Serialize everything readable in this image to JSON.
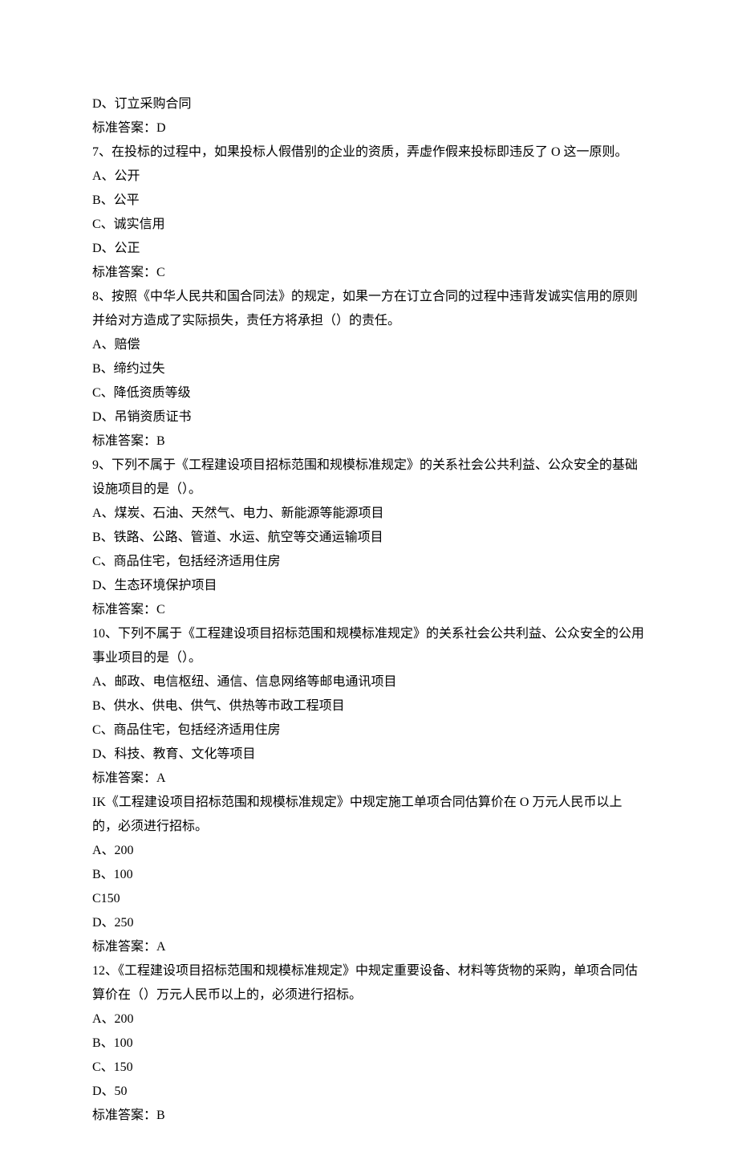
{
  "lines": [
    "D、订立采购合同",
    "标准答案：D",
    "7、在投标的过程中，如果投标人假借别的企业的资质，弄虚作假来投标即违反了 O 这一原则。",
    "A、公开",
    "",
    "B、公平",
    "C、诚实信用",
    "D、公正",
    "标准答案：C",
    "8、按照《中华人民共和国合同法》的规定，如果一方在订立合同的过程中违背发诚实信用的原则并给对方造成了实际损失，责任方将承担（）的责任。",
    "A、赔偿",
    "B、缔约过失",
    "C、降低资质等级",
    "D、吊销资质证书",
    "标准答案：B",
    "9、下列不属于《工程建设项目招标范围和规模标准规定》的关系社会公共利益、公众安全的基础设施项目的是（）。",
    "A、煤炭、石油、天然气、电力、新能源等能源项目",
    "B、铁路、公路、管道、水运、航空等交通运输项目",
    "C、商品住宅，包括经济适用住房",
    "D、生态环境保护项目",
    "标准答案：C",
    "10、下列不属于《工程建设项目招标范围和规模标准规定》的关系社会公共利益、公众安全的公用事业项目的是（）。",
    "A、邮政、电信枢纽、通信、信息网络等邮电通讯项目",
    "B、供水、供电、供气、供热等市政工程项目",
    "C、商品住宅，包括经济适用住房",
    "D、科技、教育、文化等项目",
    "标准答案：A",
    "IK《工程建设项目招标范围和规模标准规定》中规定施工单项合同估算价在 O 万元人民币以上的，必须进行招标。",
    "A、200",
    "B、100",
    "C150",
    "D、250",
    "标准答案：A",
    "12、《工程建设项目招标范围和规模标准规定》中规定重要设备、材料等货物的采购，单项合同估算价在（）万元人民币以上的，必须进行招标。",
    "A、200",
    "B、100",
    "C、150",
    "D、50",
    "标准答案：B"
  ]
}
